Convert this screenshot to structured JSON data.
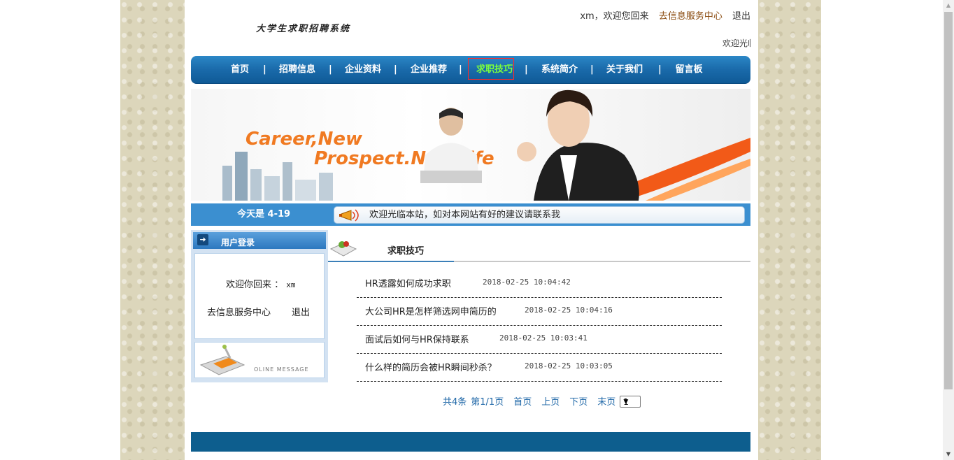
{
  "site": {
    "title": "大学生求职招聘系统"
  },
  "top": {
    "greeting": "xm，欢迎您回来",
    "service_link": "去信息服务中心",
    "logout": "退出",
    "marquee": "欢迎光临"
  },
  "nav": {
    "items": [
      {
        "label": "首页"
      },
      {
        "label": "招聘信息"
      },
      {
        "label": "企业资料"
      },
      {
        "label": "企业推荐"
      },
      {
        "label": "求职技巧"
      },
      {
        "label": "系统简介"
      },
      {
        "label": "关于我们"
      },
      {
        "label": "留言板"
      }
    ],
    "separator": "|",
    "active_index": 4
  },
  "banner": {
    "line1": "Career,New",
    "line2": "Prospect.New life"
  },
  "datebar": {
    "date": "今天是 4-19",
    "notice": "欢迎光临本站，如对本网站有好的建议请联系我"
  },
  "sidebar": {
    "login_title": "用户登录",
    "welcome_prefix": "欢迎你回来 ：",
    "welcome_user": "xm",
    "service_link": "去信息服务中心",
    "logout": "退出",
    "message_banner": "OLINE MESSAGE"
  },
  "main": {
    "section_title": "求职技巧",
    "articles": [
      {
        "title": "HR透露如何成功求职",
        "date": "2018-02-25 10:04:42"
      },
      {
        "title": "大公司HR是怎样筛选网申简历的",
        "date": "2018-02-25 10:04:16"
      },
      {
        "title": "面试后如何与HR保持联系",
        "date": "2018-02-25 10:03:41"
      },
      {
        "title": "什么样的简历会被HR瞬间秒杀？",
        "date": "2018-02-25 10:03:05"
      }
    ]
  },
  "pager": {
    "total": "共4条",
    "page_info": "第1/1页",
    "first": "首页",
    "prev": "上页",
    "next": "下页",
    "last": "末页",
    "selected_page": "1"
  },
  "colors": {
    "nav_blue": "#1a6aaa",
    "active_nav": "#7cff3c",
    "highlight_border": "#ff2b2b",
    "date_bar": "#3b8fd0",
    "footer": "#0d5e8e",
    "banner_orange": "#f07a22"
  }
}
